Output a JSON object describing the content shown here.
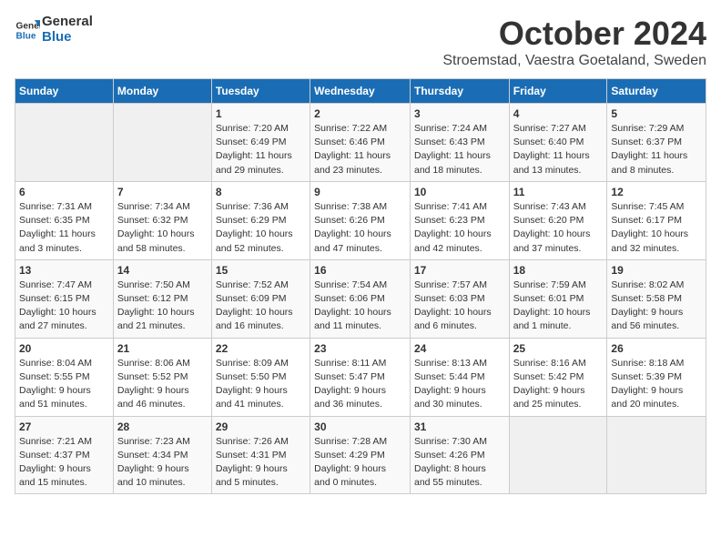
{
  "logo": {
    "line1": "General",
    "line2": "Blue"
  },
  "title": "October 2024",
  "subtitle": "Stroemstad, Vaestra Goetaland, Sweden",
  "days_of_week": [
    "Sunday",
    "Monday",
    "Tuesday",
    "Wednesday",
    "Thursday",
    "Friday",
    "Saturday"
  ],
  "weeks": [
    [
      {
        "day": "",
        "info": ""
      },
      {
        "day": "",
        "info": ""
      },
      {
        "day": "1",
        "info": "Sunrise: 7:20 AM\nSunset: 6:49 PM\nDaylight: 11 hours\nand 29 minutes."
      },
      {
        "day": "2",
        "info": "Sunrise: 7:22 AM\nSunset: 6:46 PM\nDaylight: 11 hours\nand 23 minutes."
      },
      {
        "day": "3",
        "info": "Sunrise: 7:24 AM\nSunset: 6:43 PM\nDaylight: 11 hours\nand 18 minutes."
      },
      {
        "day": "4",
        "info": "Sunrise: 7:27 AM\nSunset: 6:40 PM\nDaylight: 11 hours\nand 13 minutes."
      },
      {
        "day": "5",
        "info": "Sunrise: 7:29 AM\nSunset: 6:37 PM\nDaylight: 11 hours\nand 8 minutes."
      }
    ],
    [
      {
        "day": "6",
        "info": "Sunrise: 7:31 AM\nSunset: 6:35 PM\nDaylight: 11 hours\nand 3 minutes."
      },
      {
        "day": "7",
        "info": "Sunrise: 7:34 AM\nSunset: 6:32 PM\nDaylight: 10 hours\nand 58 minutes."
      },
      {
        "day": "8",
        "info": "Sunrise: 7:36 AM\nSunset: 6:29 PM\nDaylight: 10 hours\nand 52 minutes."
      },
      {
        "day": "9",
        "info": "Sunrise: 7:38 AM\nSunset: 6:26 PM\nDaylight: 10 hours\nand 47 minutes."
      },
      {
        "day": "10",
        "info": "Sunrise: 7:41 AM\nSunset: 6:23 PM\nDaylight: 10 hours\nand 42 minutes."
      },
      {
        "day": "11",
        "info": "Sunrise: 7:43 AM\nSunset: 6:20 PM\nDaylight: 10 hours\nand 37 minutes."
      },
      {
        "day": "12",
        "info": "Sunrise: 7:45 AM\nSunset: 6:17 PM\nDaylight: 10 hours\nand 32 minutes."
      }
    ],
    [
      {
        "day": "13",
        "info": "Sunrise: 7:47 AM\nSunset: 6:15 PM\nDaylight: 10 hours\nand 27 minutes."
      },
      {
        "day": "14",
        "info": "Sunrise: 7:50 AM\nSunset: 6:12 PM\nDaylight: 10 hours\nand 21 minutes."
      },
      {
        "day": "15",
        "info": "Sunrise: 7:52 AM\nSunset: 6:09 PM\nDaylight: 10 hours\nand 16 minutes."
      },
      {
        "day": "16",
        "info": "Sunrise: 7:54 AM\nSunset: 6:06 PM\nDaylight: 10 hours\nand 11 minutes."
      },
      {
        "day": "17",
        "info": "Sunrise: 7:57 AM\nSunset: 6:03 PM\nDaylight: 10 hours\nand 6 minutes."
      },
      {
        "day": "18",
        "info": "Sunrise: 7:59 AM\nSunset: 6:01 PM\nDaylight: 10 hours\nand 1 minute."
      },
      {
        "day": "19",
        "info": "Sunrise: 8:02 AM\nSunset: 5:58 PM\nDaylight: 9 hours\nand 56 minutes."
      }
    ],
    [
      {
        "day": "20",
        "info": "Sunrise: 8:04 AM\nSunset: 5:55 PM\nDaylight: 9 hours\nand 51 minutes."
      },
      {
        "day": "21",
        "info": "Sunrise: 8:06 AM\nSunset: 5:52 PM\nDaylight: 9 hours\nand 46 minutes."
      },
      {
        "day": "22",
        "info": "Sunrise: 8:09 AM\nSunset: 5:50 PM\nDaylight: 9 hours\nand 41 minutes."
      },
      {
        "day": "23",
        "info": "Sunrise: 8:11 AM\nSunset: 5:47 PM\nDaylight: 9 hours\nand 36 minutes."
      },
      {
        "day": "24",
        "info": "Sunrise: 8:13 AM\nSunset: 5:44 PM\nDaylight: 9 hours\nand 30 minutes."
      },
      {
        "day": "25",
        "info": "Sunrise: 8:16 AM\nSunset: 5:42 PM\nDaylight: 9 hours\nand 25 minutes."
      },
      {
        "day": "26",
        "info": "Sunrise: 8:18 AM\nSunset: 5:39 PM\nDaylight: 9 hours\nand 20 minutes."
      }
    ],
    [
      {
        "day": "27",
        "info": "Sunrise: 7:21 AM\nSunset: 4:37 PM\nDaylight: 9 hours\nand 15 minutes."
      },
      {
        "day": "28",
        "info": "Sunrise: 7:23 AM\nSunset: 4:34 PM\nDaylight: 9 hours\nand 10 minutes."
      },
      {
        "day": "29",
        "info": "Sunrise: 7:26 AM\nSunset: 4:31 PM\nDaylight: 9 hours\nand 5 minutes."
      },
      {
        "day": "30",
        "info": "Sunrise: 7:28 AM\nSunset: 4:29 PM\nDaylight: 9 hours\nand 0 minutes."
      },
      {
        "day": "31",
        "info": "Sunrise: 7:30 AM\nSunset: 4:26 PM\nDaylight: 8 hours\nand 55 minutes."
      },
      {
        "day": "",
        "info": ""
      },
      {
        "day": "",
        "info": ""
      }
    ]
  ]
}
